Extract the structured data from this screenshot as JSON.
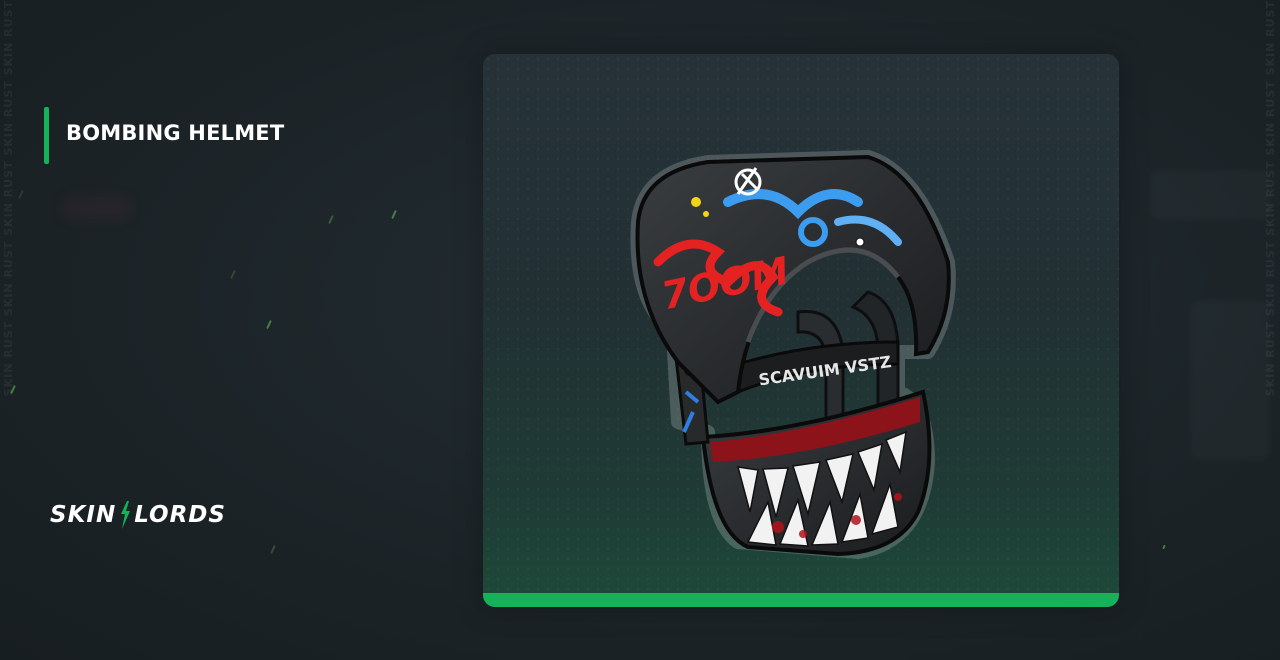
{
  "item": {
    "name": "BOMBING HELMET",
    "rarity_color": "#16b25a"
  },
  "branding": {
    "logo_text_left": "SKIN",
    "logo_text_right": "LORDS",
    "watermark": "SKIN RUST SKIN RUST SKIN RUST SKIN RUST SKIN RUST"
  },
  "icons": {
    "logo_mark": "lightning-icon",
    "item_image": "helmet-icon"
  },
  "colors": {
    "accent": "#16b25a",
    "background": "#1c2428",
    "card": "#263238"
  }
}
